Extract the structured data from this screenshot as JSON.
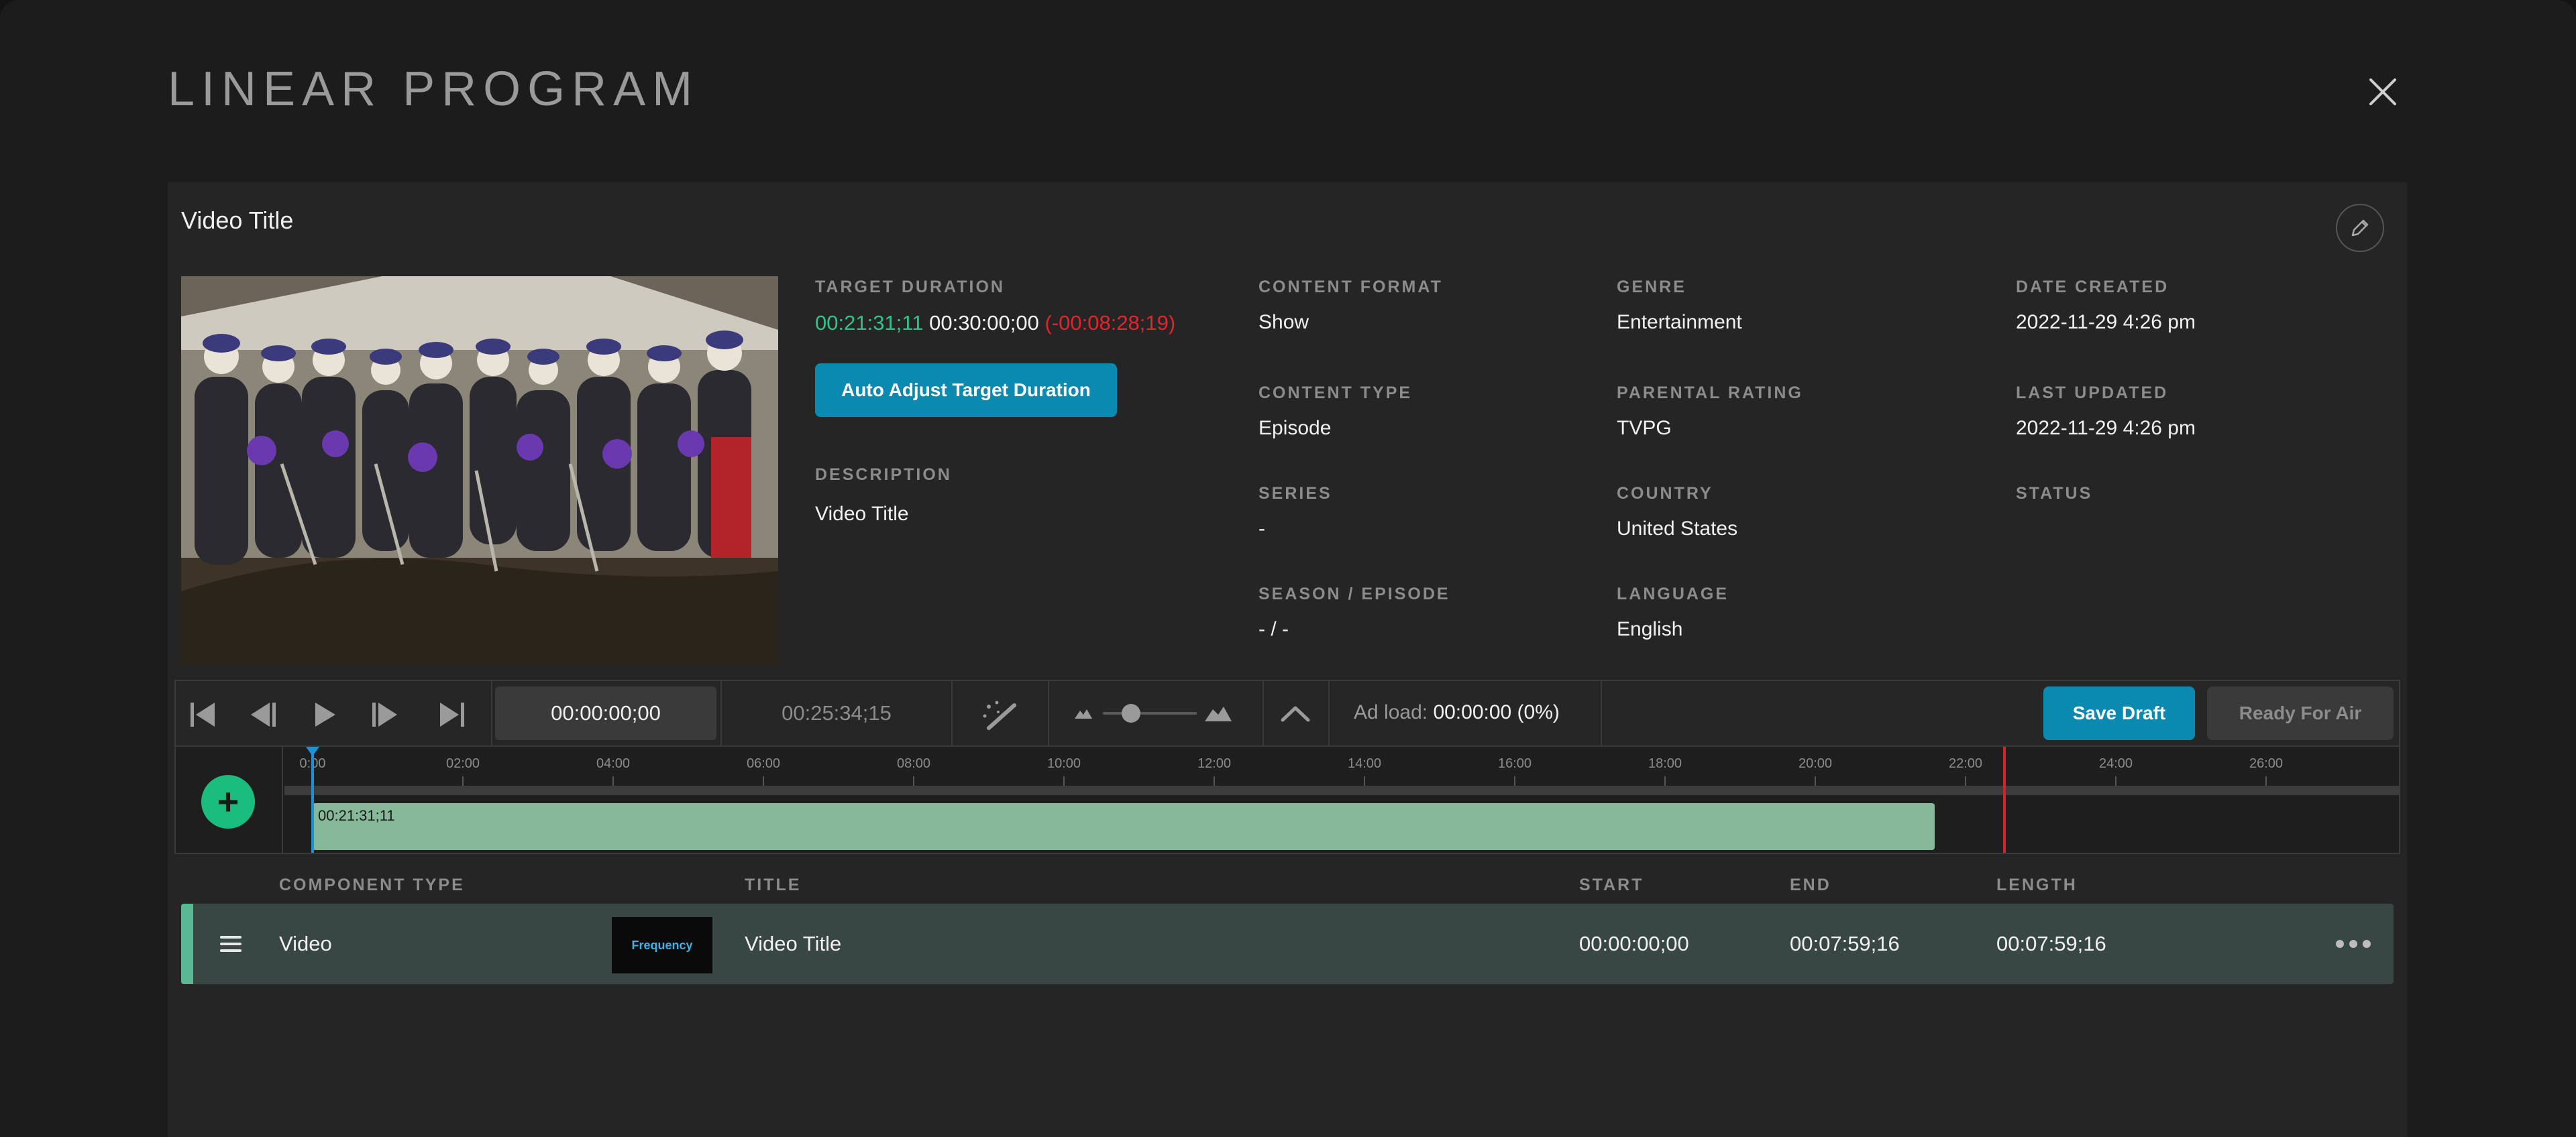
{
  "modal": {
    "title": "LINEAR PROGRAM"
  },
  "header": {
    "video_title": "Video Title"
  },
  "details": {
    "target_duration_label": "TARGET DURATION",
    "target_current": "00:21:31;11",
    "target_goal": "00:30:00;00",
    "target_diff": "(-00:08:28;19)",
    "auto_adjust_label": "Auto Adjust Target Duration",
    "description_label": "DESCRIPTION",
    "description_value": "Video Title",
    "content_format_label": "CONTENT FORMAT",
    "content_format_value": "Show",
    "content_type_label": "CONTENT TYPE",
    "content_type_value": "Episode",
    "series_label": "SERIES",
    "series_value": "-",
    "season_label": "SEASON / EPISODE",
    "season_value": "- / -",
    "genre_label": "GENRE",
    "genre_value": "Entertainment",
    "parental_label": "PARENTAL RATING",
    "parental_value": "TVPG",
    "country_label": "COUNTRY",
    "country_value": "United States",
    "language_label": "LANGUAGE",
    "language_value": "English",
    "created_label": "DATE CREATED",
    "created_value": "2022-11-29 4:26 pm",
    "updated_label": "LAST UPDATED",
    "updated_value": "2022-11-29 4:26 pm",
    "status_label": "STATUS"
  },
  "toolbar": {
    "current_timecode": "00:00:00;00",
    "total_timecode": "00:25:34;15",
    "ad_load_label": "Ad load:",
    "ad_load_value": "00:00:00 (0%)",
    "save_label": "Save Draft",
    "ready_label": "Ready For Air",
    "zoom_level": 0.3
  },
  "timeline": {
    "ticks": [
      "0:00",
      "02:00",
      "04:00",
      "06:00",
      "08:00",
      "10:00",
      "12:00",
      "14:00",
      "16:00",
      "18:00",
      "20:00",
      "22:00",
      "24:00",
      "26:00"
    ],
    "clip_label": "00:21:31;11"
  },
  "table": {
    "headers": {
      "type": "COMPONENT TYPE",
      "title": "TITLE",
      "start": "START",
      "end": "END",
      "length": "LENGTH"
    },
    "rows": [
      {
        "type": "Video",
        "thumb_text": "Frequency",
        "title": "Video Title",
        "start": "00:00:00;00",
        "end": "00:07:59;16",
        "length": "00:07:59;16"
      }
    ]
  },
  "colors": {
    "accent": "#0a8ab0",
    "green": "#34c28b",
    "red": "#e0262c",
    "clip": "#86b89a",
    "row": "#384744"
  }
}
